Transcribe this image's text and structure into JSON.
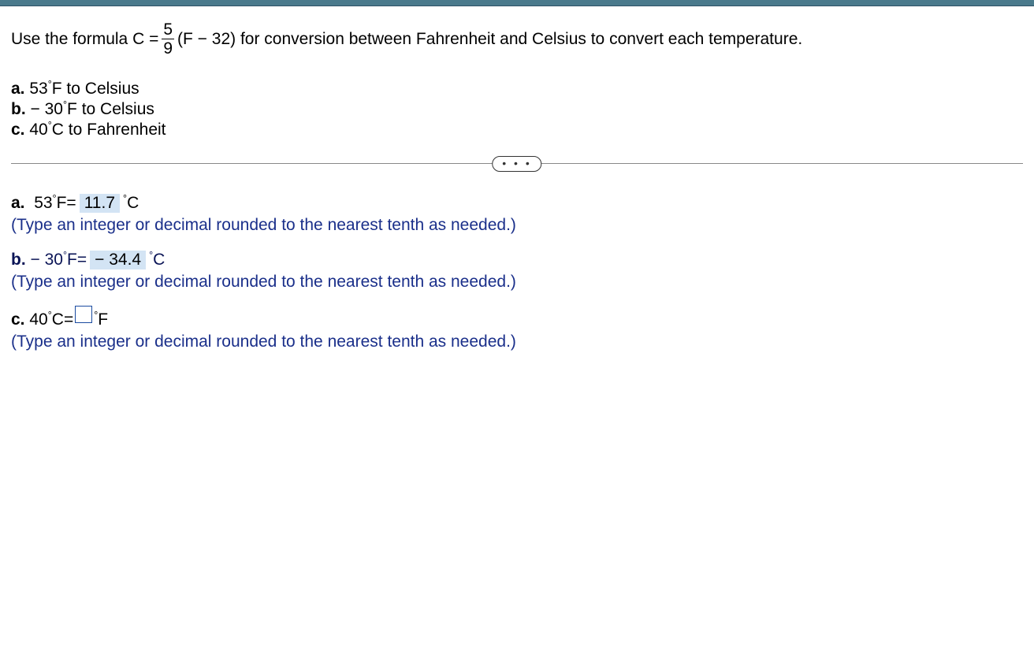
{
  "intro": {
    "pre": "Use the formula C =",
    "frac_num": "5",
    "frac_den": "9",
    "post": "(F − 32) for conversion between Fahrenheit and Celsius to convert each temperature."
  },
  "parts": {
    "a": {
      "label": "a.",
      "text": "53°F to Celsius"
    },
    "b": {
      "label": "b.",
      "text": "− 30°F to Celsius"
    },
    "c": {
      "label": "c.",
      "text": "40°C to Fahrenheit"
    }
  },
  "dots": "• • •",
  "answers": {
    "a": {
      "label": "a.",
      "lhs_val": "53",
      "lhs_unit": "°F",
      "eq": " = ",
      "value": "11.7",
      "rhs_unit": "°C",
      "hint": "(Type an integer or decimal rounded to the nearest tenth as needed.)"
    },
    "b": {
      "label": "b.",
      "lhs_prefix": "− ",
      "lhs_val": "30",
      "lhs_unit": "°F",
      "eq": " = ",
      "value": "− 34.4",
      "rhs_unit": "°C",
      "hint": "(Type an integer or decimal rounded to the nearest tenth as needed.)"
    },
    "c": {
      "label": "c.",
      "lhs_val": "40",
      "lhs_unit": "°C",
      "eq": " = ",
      "rhs_unit": "°F",
      "hint": "(Type an integer or decimal rounded to the nearest tenth as needed.)"
    }
  }
}
